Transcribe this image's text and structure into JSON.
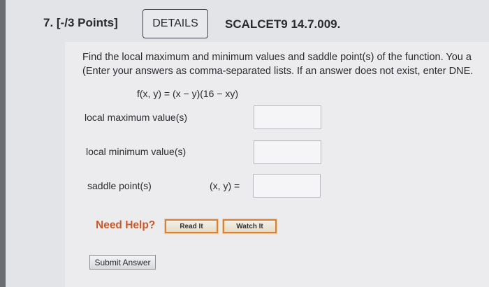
{
  "question": {
    "number_label": "7. [-/3 Points]",
    "details_label": "DETAILS",
    "course_code": "SCALCET9 14.7.009."
  },
  "instructions": {
    "line1": "Find the local maximum and minimum values and saddle point(s) of the function. You a",
    "line2": "(Enter your answers as comma-separated lists. If an answer does not exist, enter DNE."
  },
  "function": "f(x, y) = (x − y)(16 − xy)",
  "answers": {
    "local_max_label": "local maximum value(s)",
    "local_min_label": "local minimum value(s)",
    "saddle_label": "saddle point(s)",
    "saddle_prefix": "(x, y)  =",
    "local_max_value": "",
    "local_min_value": "",
    "saddle_value": ""
  },
  "help": {
    "need_help_label": "Need Help?",
    "read_it_label": "Read It",
    "watch_it_label": "Watch It"
  },
  "submit_label": "Submit Answer"
}
